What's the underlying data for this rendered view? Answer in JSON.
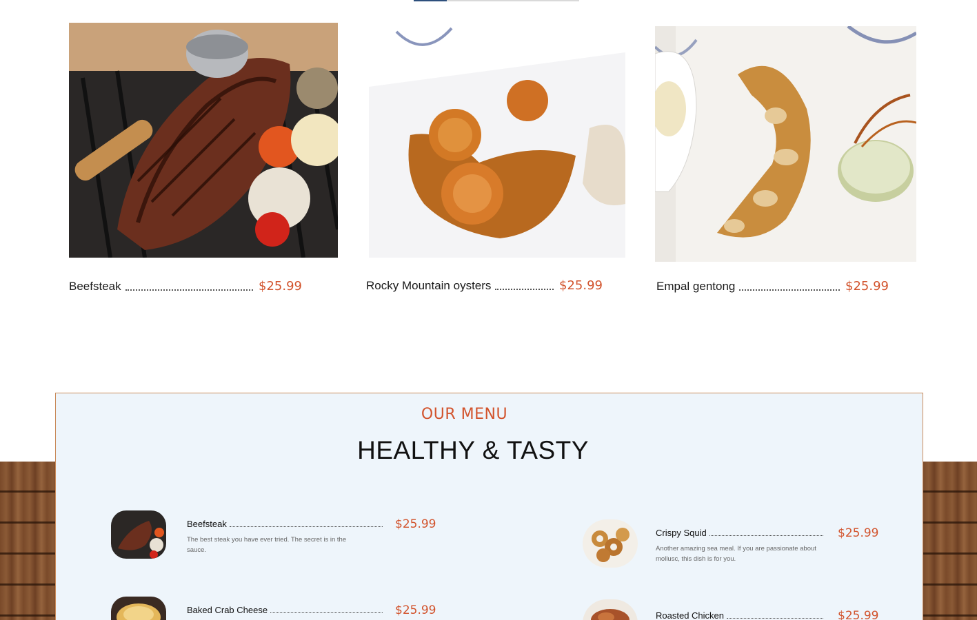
{
  "featured": [
    {
      "name": "Beefsteak",
      "price": "$25.99",
      "photo": "beefsteak-photo"
    },
    {
      "name": "Rocky Mountain oysters",
      "price": "$25.99",
      "photo": "shrimp-photo"
    },
    {
      "name": "Empal gentong",
      "price": "$25.99",
      "photo": "fried-roll-photo"
    }
  ],
  "menu": {
    "eyebrow": "OUR MENU",
    "title": "HEALTHY & TASTY",
    "items": [
      {
        "name": "Beefsteak",
        "price": "$25.99",
        "description": "The best steak you have ever tried. The secret is in the sauce."
      },
      {
        "name": "Crispy Squid",
        "price": "$25.99",
        "description": "Another amazing sea meal. If you are passionate about mollusc, this dish is for you."
      },
      {
        "name": "Baked Crab Cheese",
        "price": "$25.99",
        "description": ""
      },
      {
        "name": "Roasted Chicken",
        "price": "$25.99",
        "description": ""
      }
    ]
  },
  "colors": {
    "accent": "#d2532c",
    "panel": "#eef5fb",
    "border": "#c98a5a"
  }
}
